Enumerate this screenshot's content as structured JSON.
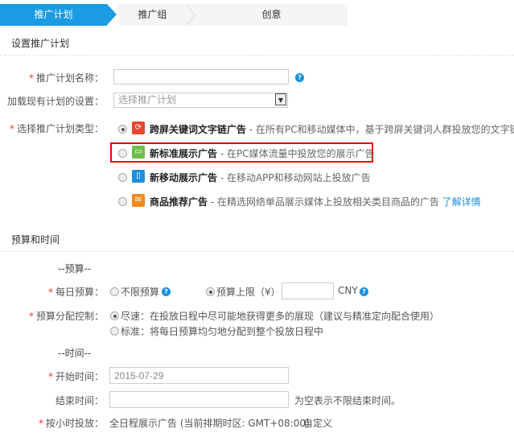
{
  "tabs": [
    {
      "label": "推广计划",
      "active": true
    },
    {
      "label": "推广组"
    },
    {
      "label": "创意"
    }
  ],
  "section_plan": {
    "title": "设置推广计划",
    "name_label": "推广计划名称：",
    "name_value": "",
    "load_label": "加载现有计划的设置：",
    "load_placeholder": "选择推广计划",
    "type_label": "选择推广计划类型：",
    "types": [
      {
        "title": "跨屏关键词文字链广告",
        "desc": " - 在所有PC和移动媒体中，基于跨屏关键词人群投放您的文字链广告",
        "icon": "cross-screen-icon",
        "color": "#e8442f",
        "selected": true
      },
      {
        "title": "新标准展示广告",
        "desc": " - 在PC媒体流量中投放您的展示广告",
        "icon": "monitor-icon",
        "color": "#6cc04a",
        "selected": false
      },
      {
        "title": "新移动展示广告",
        "desc": " - 在移动APP和移动网站上投放广告",
        "icon": "mobile-icon",
        "color": "#1f8ee0",
        "selected": false
      },
      {
        "title": "商品推荐广告",
        "desc": " - 在精选网络单品展示媒体上投放相关类目商品的广告 ",
        "icon": "product-icon",
        "color": "#f08a1c",
        "selected": false,
        "link": "了解详情"
      }
    ]
  },
  "section_budget": {
    "title": "预算和时间",
    "budget_heading": "--预算--",
    "daily_label": "每日预算：",
    "unlimited": "不限预算",
    "limit": "预算上限（¥）",
    "limit_value": "",
    "currency": "CNY",
    "alloc_label": "预算分配控制：",
    "alloc_fast": "尽速：在投放日程中尽可能地获得更多的展现（建议与精准定向配合使用）",
    "alloc_std": "标准：将每日预算均匀地分配到整个投放日程中",
    "time_heading": "--时间--",
    "start_label": "开始时间：",
    "start_value": "2015-07-29",
    "end_label": "结束时间：",
    "end_value": "",
    "end_hint": "为空表示不限结束时间。",
    "hour_label": "按小时投放：",
    "hour_value": "全日程展示广告 (当前排期时区: GMT+08:00)",
    "hour_link": "自定义"
  },
  "colors": {
    "accent": "#1a9be2",
    "required": "#e33",
    "highlight": "#e00"
  }
}
